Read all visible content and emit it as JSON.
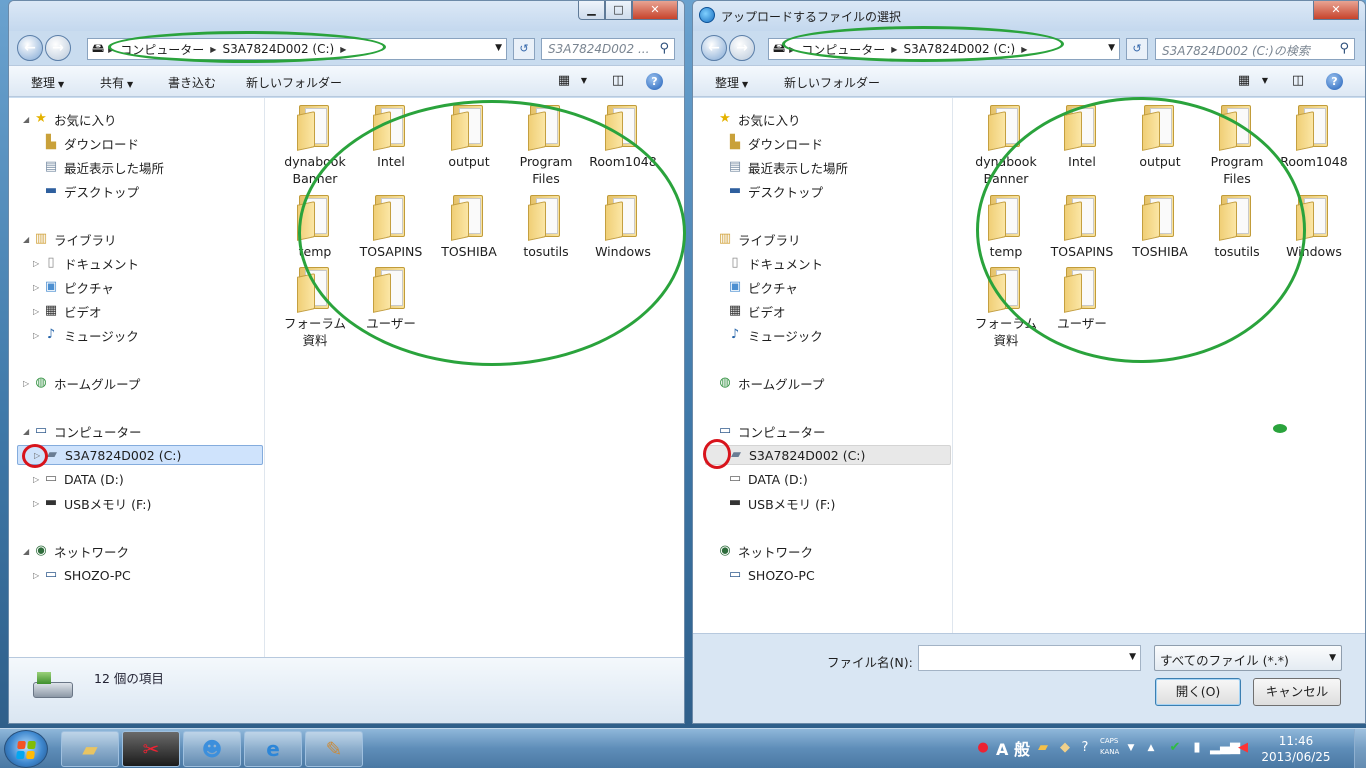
{
  "explorer": {
    "address": [
      "コンピューター",
      "S3A7824D002 (C:)"
    ],
    "search_placeholder": "S3A7824D002 ...",
    "toolbar": [
      "整理",
      "共有",
      "書き込む",
      "新しいフォルダー"
    ],
    "status": "12 個の項目"
  },
  "dialog": {
    "title": "アップロードするファイルの選択",
    "address": [
      "コンピューター",
      "S3A7824D002 (C:)"
    ],
    "search_placeholder": "S3A7824D002 (C:)の検索",
    "toolbar": [
      "整理",
      "新しいフォルダー"
    ],
    "filename_label": "ファイル名(N):",
    "filename_value": "",
    "filter": "すべてのファイル (*.*)",
    "open_label": "開く(O)",
    "cancel_label": "キャンセル"
  },
  "nav": {
    "favorites": "お気に入り",
    "downloads": "ダウンロード",
    "recent": "最近表示した場所",
    "desktop": "デスクトップ",
    "libraries": "ライブラリ",
    "documents": "ドキュメント",
    "pictures": "ピクチャ",
    "videos": "ビデオ",
    "music": "ミュージック",
    "homegroup": "ホームグループ",
    "computer": "コンピューター",
    "drive_c": "S3A7824D002 (C:)",
    "drive_d": "DATA (D:)",
    "drive_f": "USBメモリ (F:)",
    "network": "ネットワーク",
    "pc": "SHOZO-PC"
  },
  "folders": [
    {
      "line1": "dynabook",
      "line2": "Banner"
    },
    {
      "line1": "Intel",
      "line2": ""
    },
    {
      "line1": "output",
      "line2": ""
    },
    {
      "line1": "Program",
      "line2": "Files"
    },
    {
      "line1": "Room1048",
      "line2": ""
    },
    {
      "line1": "temp",
      "line2": ""
    },
    {
      "line1": "TOSAPINS",
      "line2": ""
    },
    {
      "line1": "TOSHIBA",
      "line2": ""
    },
    {
      "line1": "tosutils",
      "line2": ""
    },
    {
      "line1": "Windows",
      "line2": ""
    },
    {
      "line1": "フォーラム",
      "line2": "資料"
    },
    {
      "line1": "ユーザー",
      "line2": ""
    }
  ],
  "tray": {
    "ime": "A 般",
    "caps": "CAPS",
    "kana": "KANA",
    "time": "11:46",
    "date": "2013/06/25"
  }
}
